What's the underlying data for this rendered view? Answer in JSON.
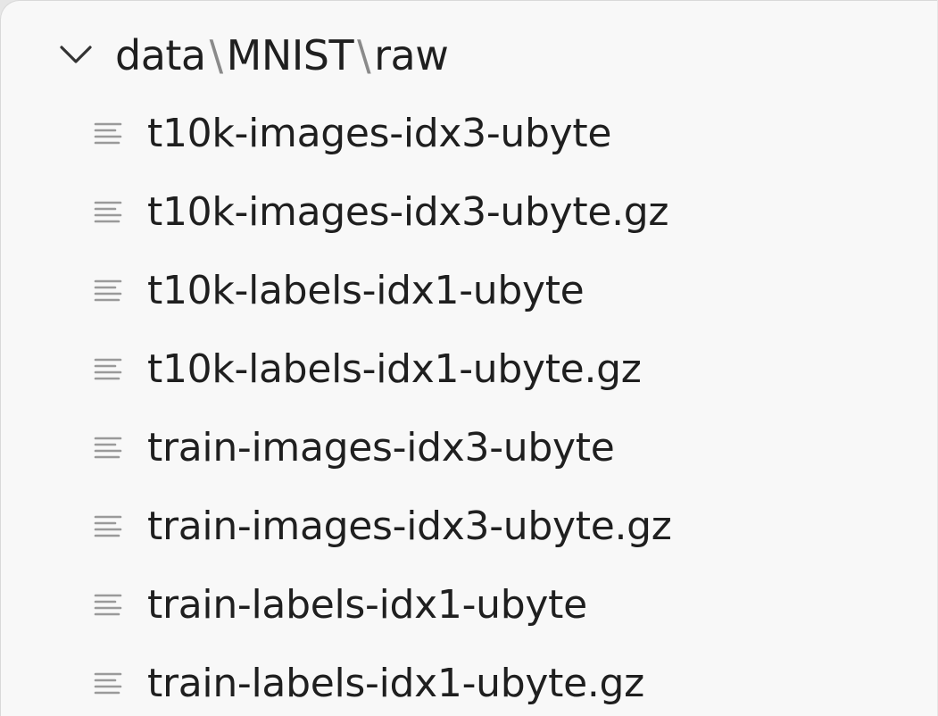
{
  "explorer": {
    "folder": {
      "expanded_icon": "chevron-down-icon",
      "segments": [
        "data",
        "MNIST",
        "raw"
      ],
      "separator": "\\"
    },
    "files": [
      {
        "name": "t10k-images-idx3-ubyte",
        "icon": "file-text-icon"
      },
      {
        "name": "t10k-images-idx3-ubyte.gz",
        "icon": "file-text-icon"
      },
      {
        "name": "t10k-labels-idx1-ubyte",
        "icon": "file-text-icon"
      },
      {
        "name": "t10k-labels-idx1-ubyte.gz",
        "icon": "file-text-icon"
      },
      {
        "name": "train-images-idx3-ubyte",
        "icon": "file-text-icon"
      },
      {
        "name": "train-images-idx3-ubyte.gz",
        "icon": "file-text-icon"
      },
      {
        "name": "train-labels-idx1-ubyte",
        "icon": "file-text-icon"
      },
      {
        "name": "train-labels-idx1-ubyte.gz",
        "icon": "file-text-icon"
      }
    ]
  },
  "colors": {
    "background": "#f8f8f8",
    "text": "#1f1f1f",
    "icon": "#9a9a9a",
    "separator": "#8a8a8a"
  }
}
